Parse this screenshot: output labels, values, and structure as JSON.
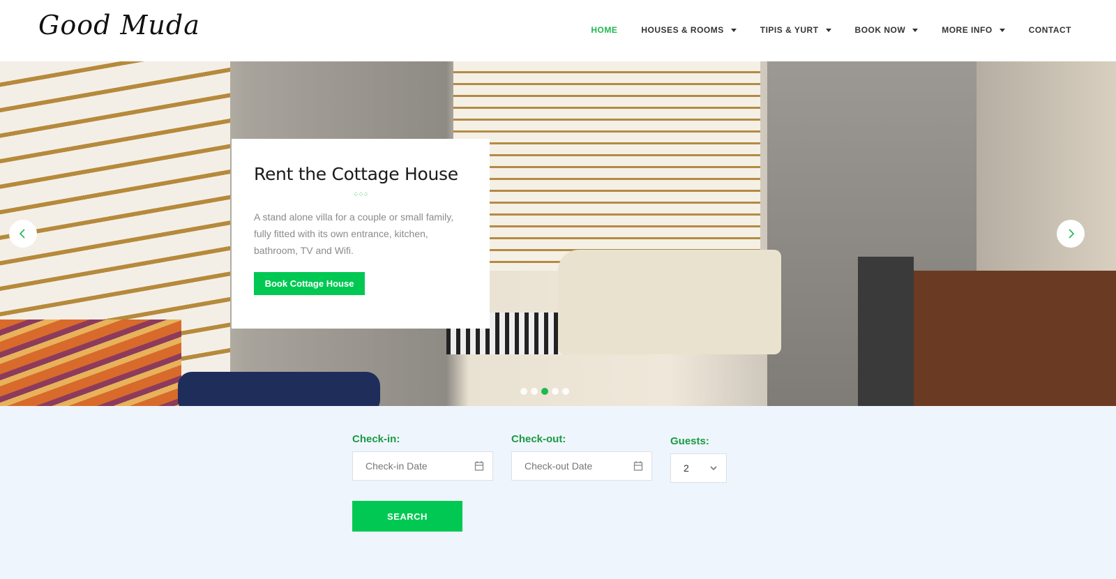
{
  "logo": "Good Muda",
  "nav": [
    {
      "label": "HOME",
      "active": true,
      "dropdown": false
    },
    {
      "label": "HOUSES & ROOMS",
      "dropdown": true
    },
    {
      "label": "TIPIS & YURT",
      "dropdown": true
    },
    {
      "label": "BOOK NOW",
      "dropdown": true
    },
    {
      "label": "MORE INFO",
      "dropdown": true
    },
    {
      "label": "CONTACT",
      "dropdown": false
    }
  ],
  "slider": {
    "title": "Rent the Cottage House",
    "description": "A stand alone villa for a couple or small family, fully fitted with its own entrance, kitchen, bathroom, TV and Wifi.",
    "cta": "Book Cottage House",
    "slide_count": 5,
    "active_slide": 3
  },
  "booking": {
    "checkin_label": "Check-in:",
    "checkin_placeholder": "Check-in Date",
    "checkout_label": "Check-out:",
    "checkout_placeholder": "Check-out Date",
    "guests_label": "Guests:",
    "guests_value": "2",
    "search_label": "SEARCH"
  },
  "colors": {
    "accent": "#00c853",
    "label_green": "#1a9a44",
    "background": "#eef5fc"
  }
}
